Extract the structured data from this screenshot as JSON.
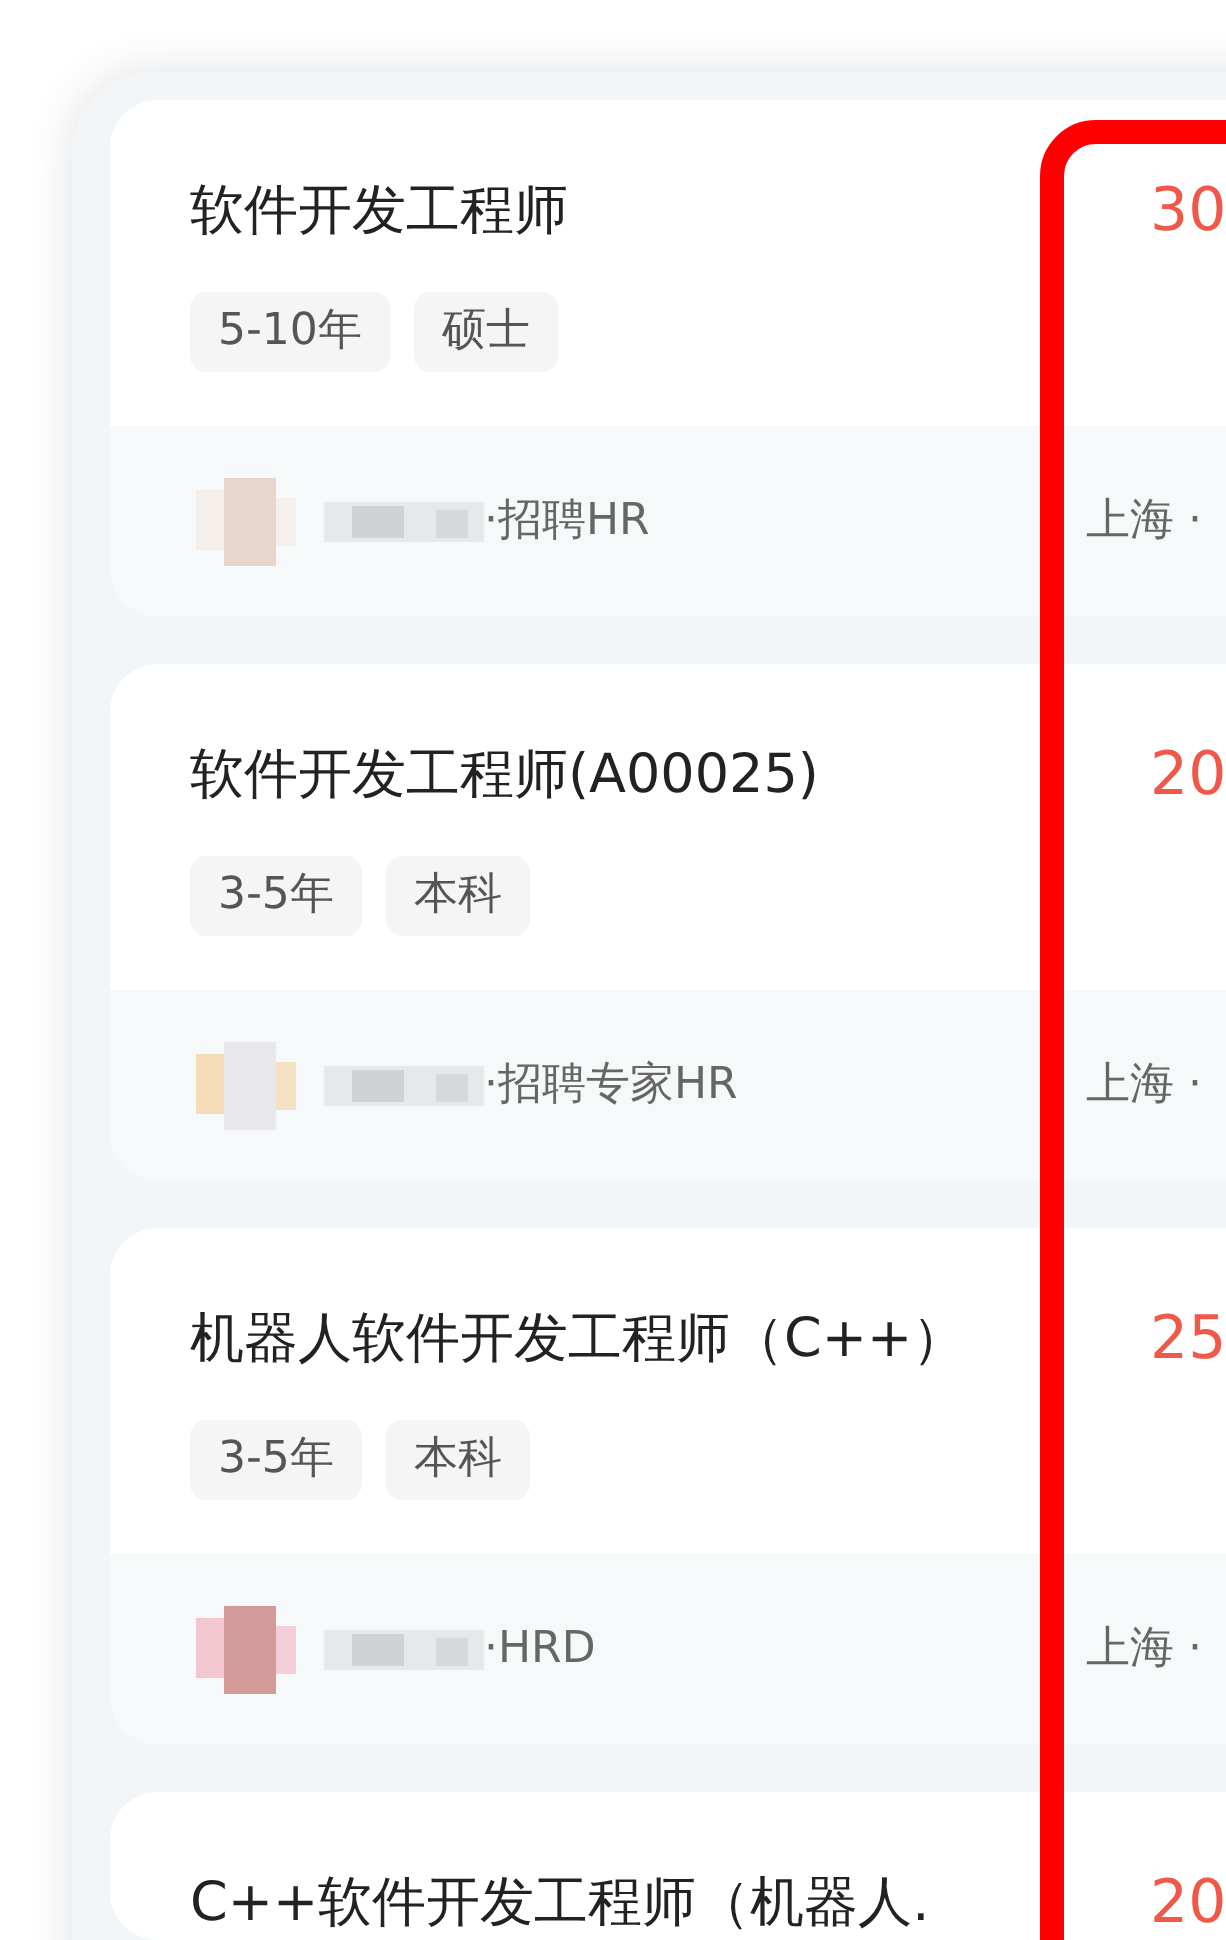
{
  "jobs": [
    {
      "title": "软件开发工程师",
      "salary": "30",
      "tags": [
        "5-10年",
        "硕士"
      ],
      "recruiter_role": "·招聘HR",
      "location": "上海 ·"
    },
    {
      "title": "软件开发工程师(A00025)",
      "salary": "20",
      "tags": [
        "3-5年",
        "本科"
      ],
      "recruiter_role": "·招聘专家HR",
      "location": "上海 ·"
    },
    {
      "title": "机器人软件开发工程师（C++）",
      "salary": "25",
      "tags": [
        "3-5年",
        "本科"
      ],
      "recruiter_role": "·HRD",
      "location": "上海 ·"
    },
    {
      "title": "C++软件开发工程师（机器人.",
      "salary": "20"
    }
  ],
  "highlight_frame": true
}
